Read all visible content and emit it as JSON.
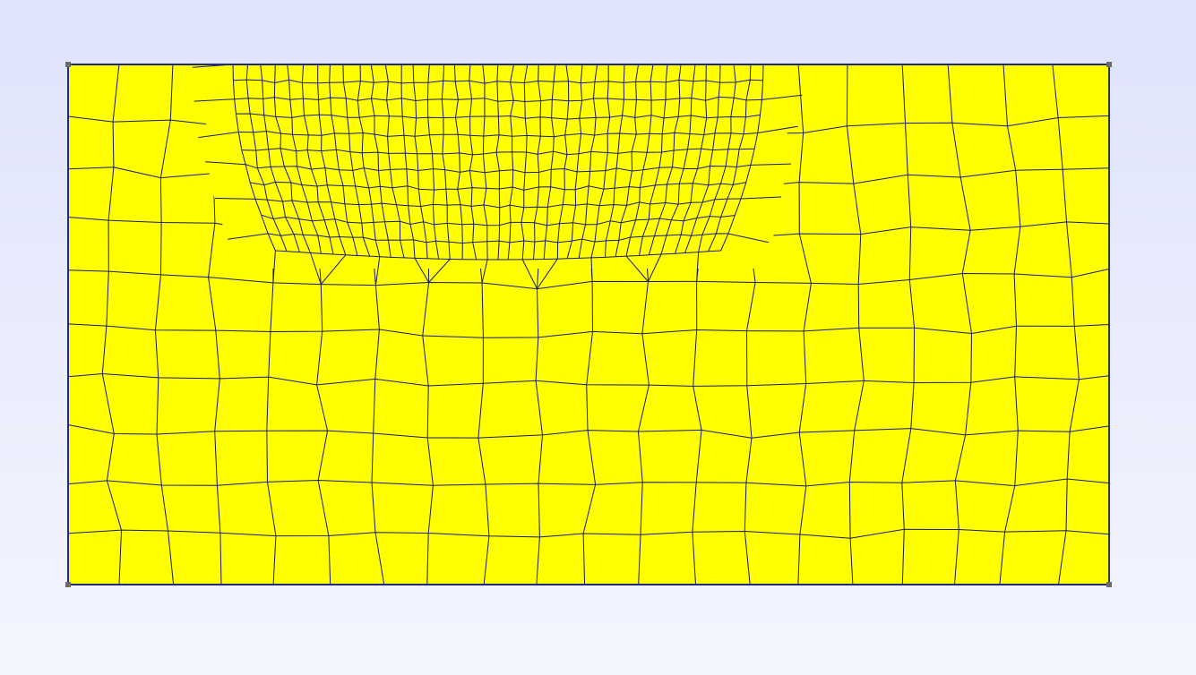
{
  "viewer": {
    "background_top": "#dfe3fb",
    "background_bottom": "#f3f5fe"
  },
  "mesh": {
    "element_type": "quadrilateral",
    "fill_color": "#ffff00",
    "edge_color": "#1a1a6e",
    "boundary_color": "#1f2a80",
    "corner_marker_color": "#6b6b6b",
    "refined_region": "upper-center"
  }
}
